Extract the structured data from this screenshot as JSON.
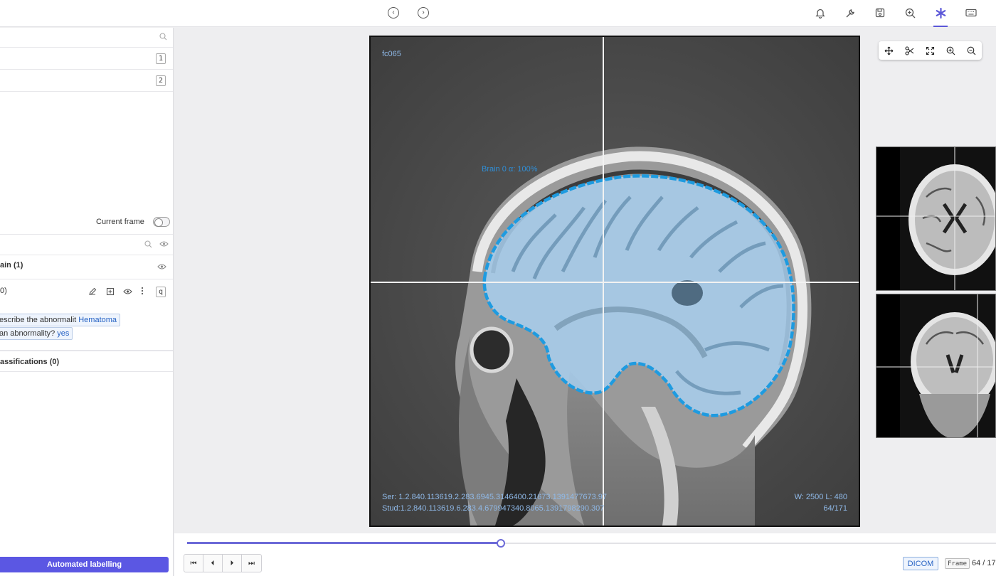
{
  "topbar": {
    "nav": {
      "back_symbol": "‹",
      "forward_symbol": "›"
    },
    "tools": [
      "bell-icon",
      "wrench-icon",
      "save-icon",
      "zoom-in-icon",
      "asterisk-icon",
      "keyboard-icon"
    ],
    "active_tool": "asterisk-icon",
    "accent": "#5b57d8"
  },
  "sidebar": {
    "list_keys": [
      "1",
      "2"
    ],
    "current_frame_label": "Current frame",
    "object_group": "ain (1)",
    "object_item": "0)",
    "object_hotkey": "q",
    "attributes": [
      {
        "question": "escribe the abnormalit",
        "answer": "Hematoma"
      },
      {
        "question": "an abnormality?",
        "answer": "yes"
      }
    ],
    "classifications": "assifications (0)",
    "automated_button": "Automated labelling"
  },
  "viewer": {
    "study_tag": "fc065",
    "label": "Brain 0 α: 100%",
    "series": "Ser: 1.2.840.113619.2.283.6945.3146400.21673.1391477673.97",
    "study": "Stud:1.2.840.113619.6.283.4.679947340.8065.1391798290.307",
    "window": "W: 2500 L: 480",
    "slice": "64/171",
    "tools": [
      "move-icon",
      "scissors-icon",
      "fit-icon",
      "zoom-in-icon",
      "zoom-out-icon"
    ],
    "outline_color": "#1e9be0"
  },
  "playback": {
    "progress": 0.388,
    "buttons": [
      "⏮",
      "⏴",
      "⏵",
      "⏭"
    ],
    "dicom_label": "DICOM",
    "frame_tag": "Frame",
    "frame_value": "64 / 17"
  }
}
